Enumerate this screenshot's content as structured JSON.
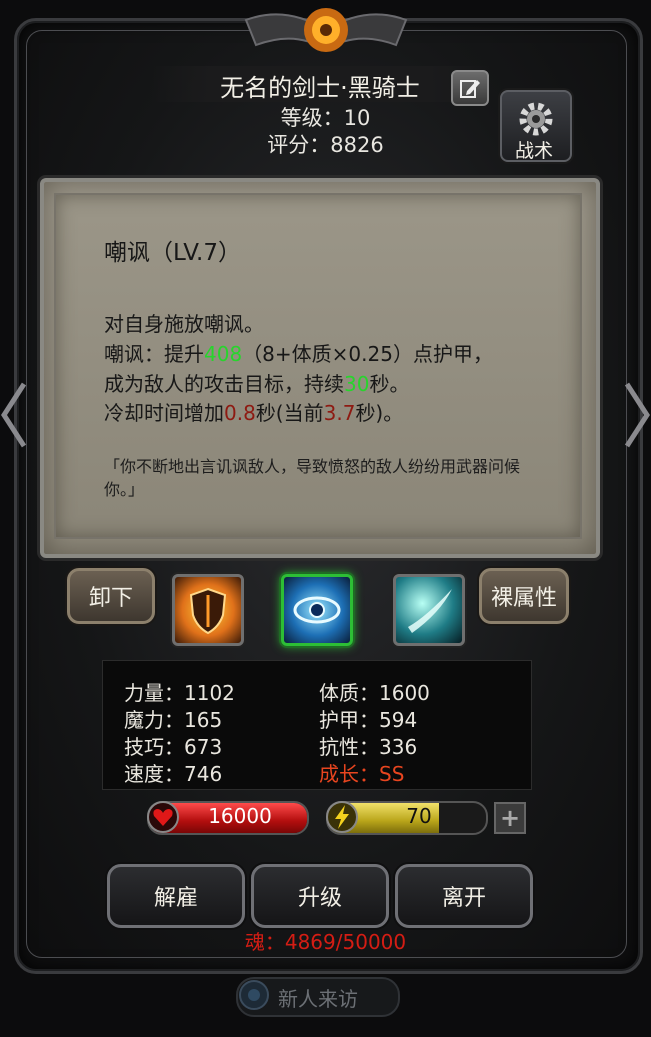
{
  "hero": {
    "name": "无名的剑士·黑骑士",
    "level_line": "等级：10",
    "score_line": "评分：8826"
  },
  "tactics": {
    "label": "战术"
  },
  "skill": {
    "title": "嘲讽（LV.7）",
    "line1": "对自身施放嘲讽。",
    "line2_pre": "嘲讽：提升",
    "line2_val": "408",
    "line2_post": "（8+体质×0.25）点护甲，",
    "line3_pre": "成为敌人的攻击目标，持续",
    "line3_val": "30",
    "line3_post": "秒。",
    "line4_pre": "冷却时间增加",
    "line4_val": "0.8",
    "line4_mid": "秒(当前",
    "line4_val2": "3.7",
    "line4_post": "秒)。",
    "quote": "「你不断地出言讥讽敌人，导致愤怒的敌人纷纷用武器问候你。」"
  },
  "buttons": {
    "unequip": "卸下",
    "base_attr": "裸属性",
    "dismiss": "解雇",
    "upgrade": "升级",
    "leave": "离开"
  },
  "skill_icons": [
    "shield-skill-icon",
    "eye-skill-icon",
    "slash-skill-icon"
  ],
  "attributes": {
    "left": [
      {
        "text": "力量：1102"
      },
      {
        "text": "魔力：165"
      },
      {
        "text": "技巧：673"
      },
      {
        "text": "速度：746"
      }
    ],
    "right": [
      {
        "text": "体质：1600"
      },
      {
        "text": "护甲：594"
      },
      {
        "text": "抗性：336"
      },
      {
        "text": "成长：SS"
      }
    ]
  },
  "hp": {
    "value": "16000",
    "fill_pct": 100
  },
  "energy": {
    "value": "70",
    "fill_pct": 70
  },
  "soul": "魂：4869/50000",
  "newcomer": "新人来访",
  "colors": {
    "growth": "#e8451f",
    "soul": "#d41d14",
    "highlight_green": "#27d52c",
    "highlight_red": "#8e1a12"
  }
}
